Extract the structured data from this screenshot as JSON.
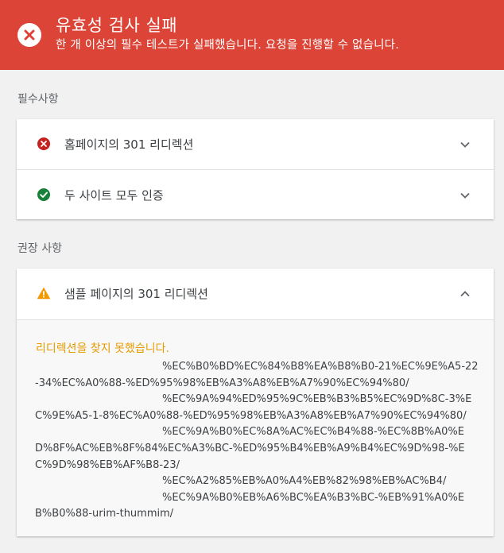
{
  "banner": {
    "title": "유효성 검사 실패",
    "subtitle": "한 개 이상의 필수 테스트가 실패했습니다. 요청을 진행할 수 없습니다.",
    "icon": "error-circle-icon",
    "color": "#db4437"
  },
  "required": {
    "label": "필수사항",
    "items": [
      {
        "label": "홈페이지의 301 리디렉션",
        "status": "failed",
        "icon": "error-icon"
      },
      {
        "label": "두 사이트 모두 인증",
        "status": "passed",
        "icon": "check-icon"
      }
    ]
  },
  "recommended": {
    "label": "권장 사항",
    "items": [
      {
        "label": "샘플 페이지의 301 리디렉션",
        "status": "warning",
        "icon": "warning-icon",
        "expanded": true,
        "message": "리디렉션을 찾지 못했습니다.",
        "urls": [
          "%EC%B0%BD%EC%84%B8%EA%B8%B0-21%EC%9E%A5-22-34%EC%A0%88-%ED%95%98%EB%A3%A8%EB%A7%90%EC%94%80/",
          "%EC%9A%94%ED%95%9C%EB%B3%B5%EC%9D%8C-3%EC%9E%A5-1-8%EC%A0%88-%ED%95%98%EB%A3%A8%EB%A7%90%EC%94%80/",
          "%EC%9A%B0%EC%8A%AC%EC%B4%88-%EC%8B%A0%ED%8F%AC%EB%8F%84%EC%A3%BC-%ED%95%B4%EB%A9%B4%EC%9D%98-%EC%9D%98%EB%AF%B8-23/",
          "%EC%A2%85%EB%A0%A4%EB%82%98%EB%AC%B4/",
          "%EC%9A%B0%EB%A6%BC%EA%B3%BC-%EB%91%A0%EB%B0%88-urim-thummim/"
        ]
      }
    ]
  },
  "colors": {
    "error": "#d93025",
    "success": "#188038",
    "warning": "#f29900",
    "warning_text": "#e69b00"
  }
}
